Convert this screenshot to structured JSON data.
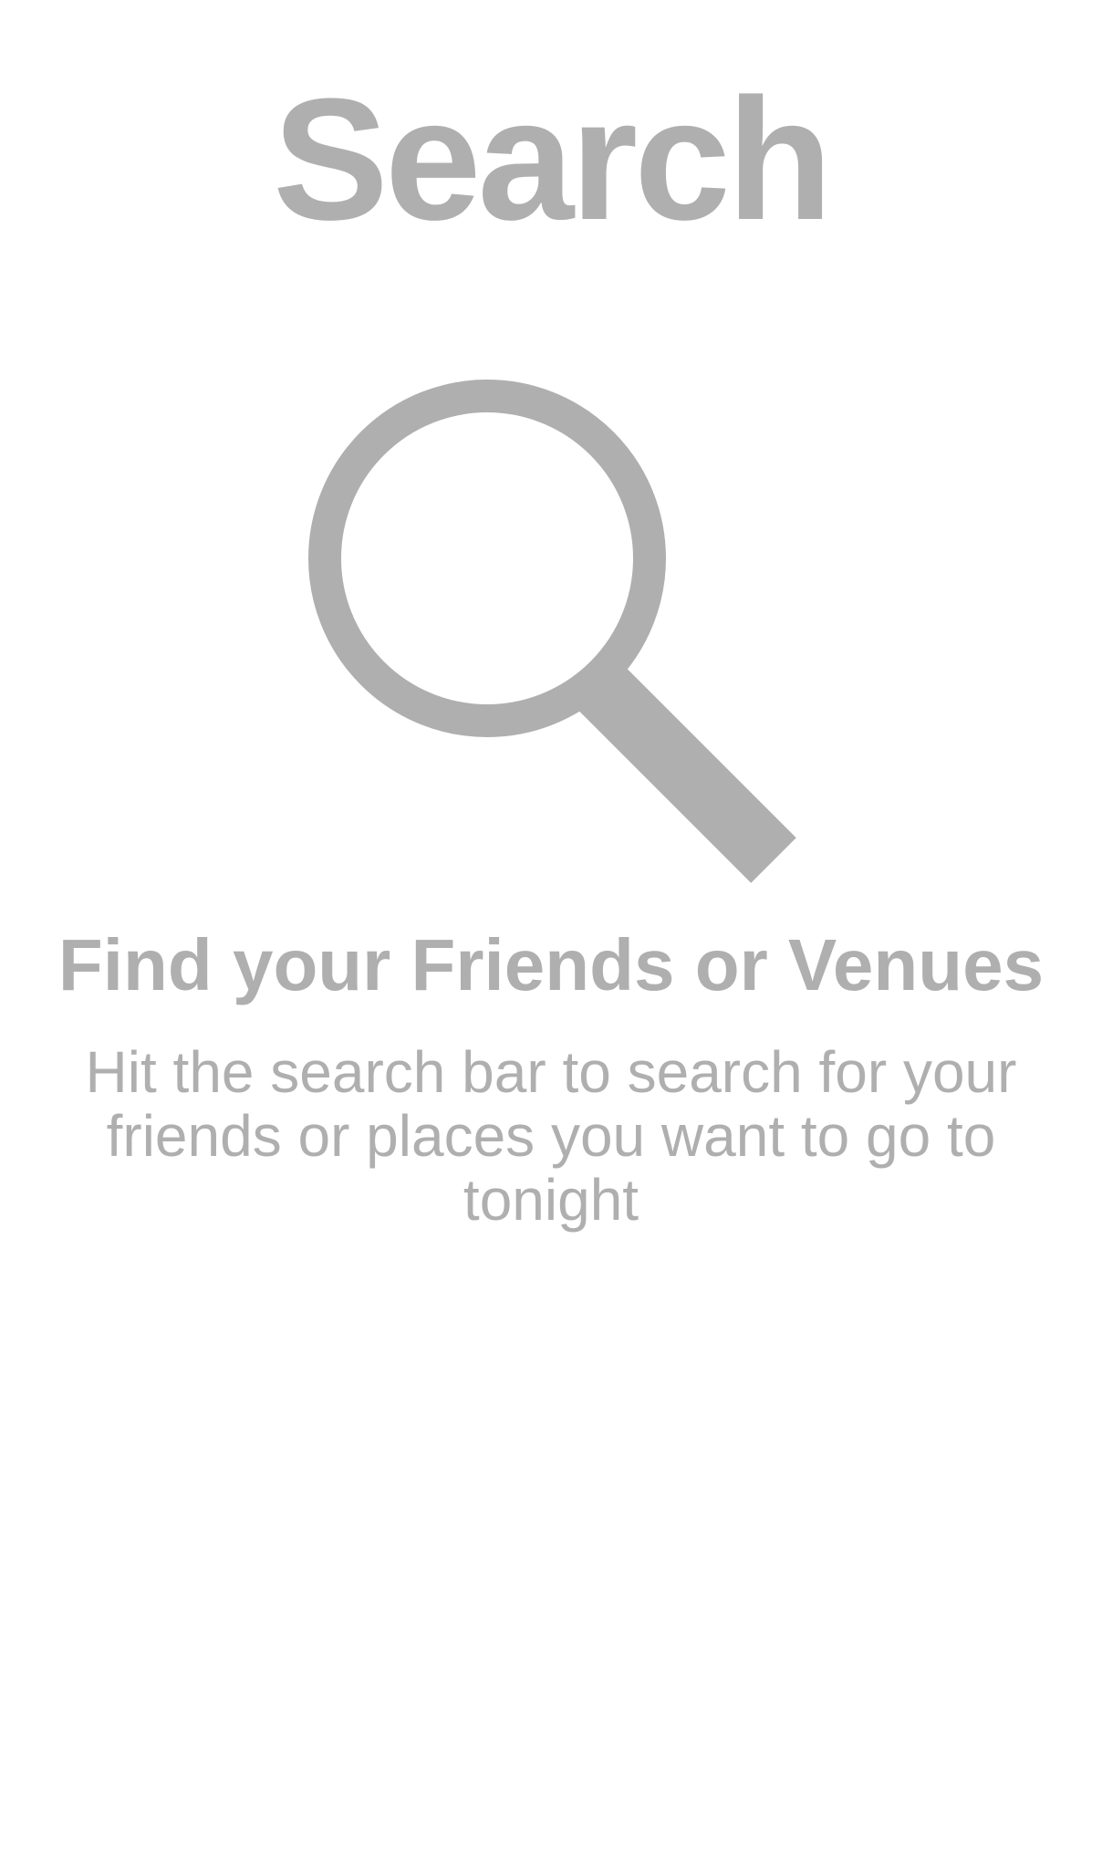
{
  "header": {
    "title": "Search"
  },
  "empty_state": {
    "icon": "search-icon",
    "heading": "Find your Friends or Venues",
    "description": "Hit the search bar to search for your friends or places you want to go to tonight"
  },
  "colors": {
    "background": "#ffffff",
    "text_gray": "#afafaf"
  }
}
